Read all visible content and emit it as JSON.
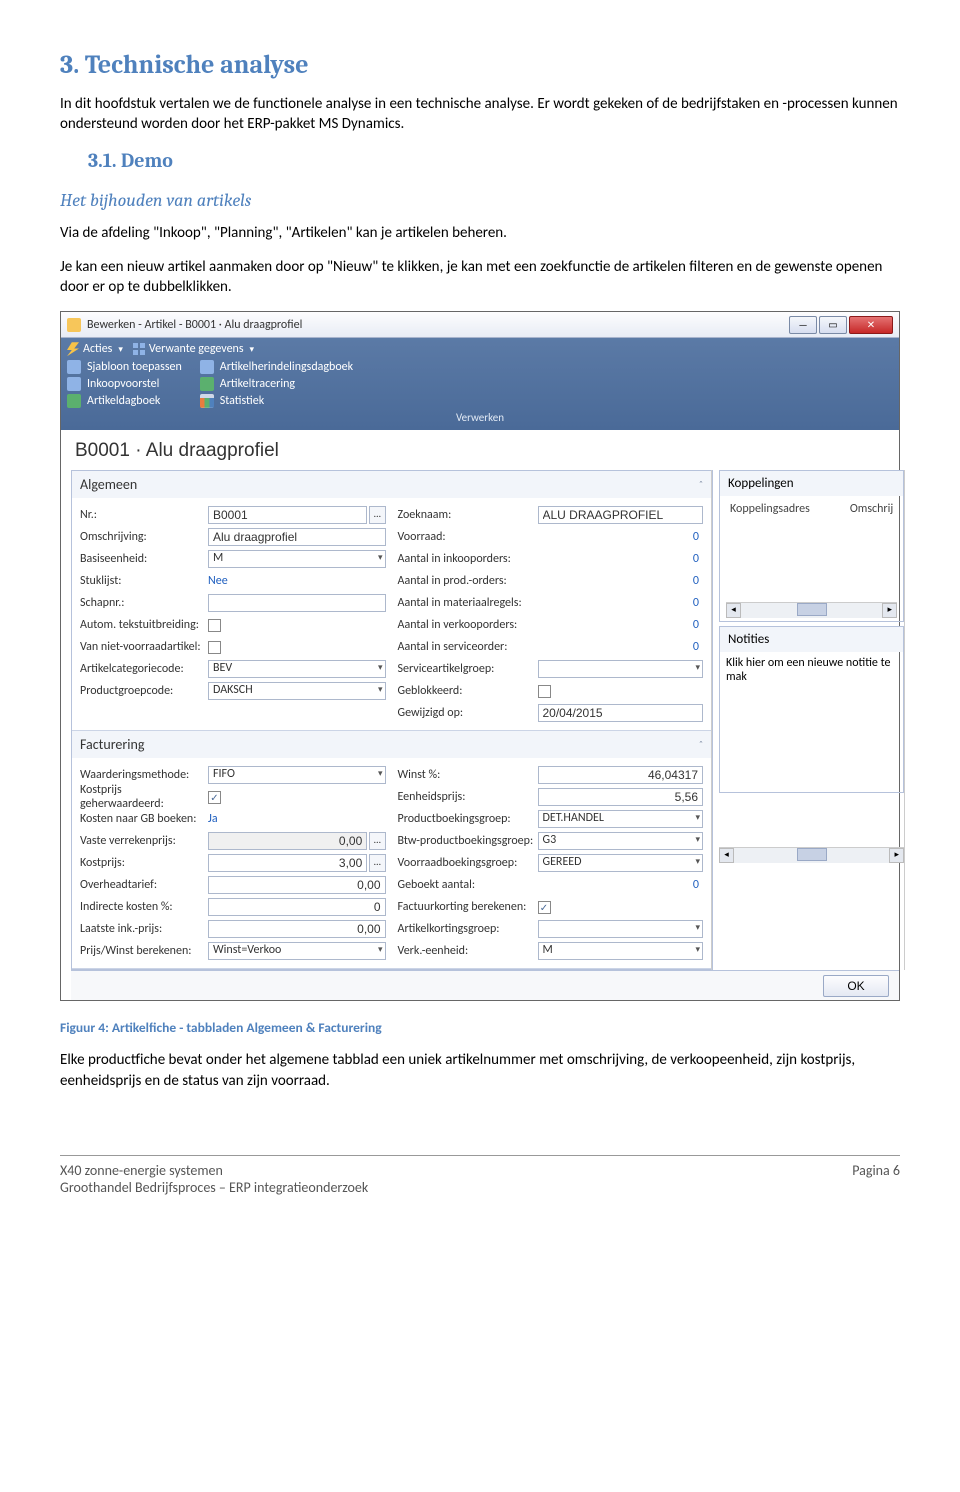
{
  "doc": {
    "h1": "3. Technische analyse",
    "p1": "In dit hoofdstuk vertalen we de functionele analyse in een technische analyse. Er wordt gekeken of de bedrijfstaken en -processen kunnen ondersteund worden door het ERP-pakket MS Dynamics.",
    "h2": "3.1.   Demo",
    "h3": "Het bijhouden van artikels",
    "p2": "Via de afdeling \"Inkoop\", \"Planning\", \"Artikelen\" kan je artikelen beheren.",
    "p3": "Je kan een nieuw artikel aanmaken door op \"Nieuw\" te klikken, je kan met een zoekfunctie de artikelen filteren en de gewenste openen door er op te dubbelklikken.",
    "caption": "Figuur 4: Artikelfiche - tabbladen Algemeen & Facturering",
    "p4": "Elke productfiche bevat onder het algemene tabblad een uniek artikelnummer met omschrijving, de verkoopeenheid, zijn kostprijs, eenheidsprijs en de status van zijn voorraad."
  },
  "win": {
    "title": "Bewerken - Artikel - B0001 · Alu draagprofiel",
    "ribbon": {
      "acties": "Acties",
      "verwante": "Verwante gegevens",
      "col1": [
        "Sjabloon toepassen",
        "Inkoopvoorstel",
        "Artikeldagboek"
      ],
      "col2": [
        "Artikelherindelingsdagboek",
        "Artikeltracering",
        "Statistiek"
      ],
      "group": "Verwerken"
    },
    "doctitle": "B0001 · Alu draagprofiel",
    "section_algemeen": "Algemeen",
    "section_facturering": "Facturering",
    "algemeen_left": {
      "nr": {
        "label": "Nr.:",
        "value": "B0001"
      },
      "omschrijving": {
        "label": "Omschrijving:",
        "value": "Alu draagprofiel"
      },
      "basiseenheid": {
        "label": "Basiseenheid:",
        "value": "M"
      },
      "stuklijst": {
        "label": "Stuklijst:",
        "value": "Nee"
      },
      "schapnr": {
        "label": "Schapnr.:",
        "value": ""
      },
      "autom": {
        "label": "Autom. tekstuitbreiding:",
        "checked": false
      },
      "vanniet": {
        "label": "Van niet-voorraadartikel:",
        "checked": false
      },
      "artcat": {
        "label": "Artikelcategoriecode:",
        "value": "BEV"
      },
      "prodgrp": {
        "label": "Productgroepcode:",
        "value": "DAKSCH"
      }
    },
    "algemeen_right": {
      "zoeknaam": {
        "label": "Zoeknaam:",
        "value": "ALU DRAAGPROFIEL"
      },
      "voorraad": {
        "label": "Voorraad:",
        "value": "0"
      },
      "inkoop": {
        "label": "Aantal in inkooporders:",
        "value": "0"
      },
      "prod": {
        "label": "Aantal in prod.-orders:",
        "value": "0"
      },
      "mat": {
        "label": "Aantal in materiaalregels:",
        "value": "0"
      },
      "verk": {
        "label": "Aantal in verkooporders:",
        "value": "0"
      },
      "serv": {
        "label": "Aantal in serviceorder:",
        "value": "0"
      },
      "servgrp": {
        "label": "Serviceartikelgroep:",
        "value": ""
      },
      "gebl": {
        "label": "Geblokkeerd:",
        "checked": false
      },
      "gewij": {
        "label": "Gewijzigd op:",
        "value": "20/04/2015"
      }
    },
    "fact_left": {
      "waard": {
        "label": "Waarderingsmethode:",
        "value": "FIFO"
      },
      "kostg": {
        "label": "Kostprijs geherwaardeerd:",
        "checked": true
      },
      "kostgb": {
        "label": "Kosten naar GB boeken:",
        "value": "Ja"
      },
      "vaste": {
        "label": "Vaste verrekenprijs:",
        "value": "0,00"
      },
      "kostprijs": {
        "label": "Kostprijs:",
        "value": "3,00"
      },
      "overhead": {
        "label": "Overheadtarief:",
        "value": "0,00"
      },
      "indirect": {
        "label": "Indirecte kosten %:",
        "value": "0"
      },
      "laatste": {
        "label": "Laatste ink.-prijs:",
        "value": "0,00"
      },
      "prijswinst": {
        "label": "Prijs/Winst berekenen:",
        "value": "Winst=Verkoo"
      }
    },
    "fact_right": {
      "winst": {
        "label": "Winst %:",
        "value": "46,04317"
      },
      "eenh": {
        "label": "Eenheidsprijs:",
        "value": "5,56"
      },
      "prodb": {
        "label": "Productboekingsgroep:",
        "value": "DET.HANDEL"
      },
      "btw": {
        "label": "Btw-productboekingsgroep:",
        "value": "G3"
      },
      "voorb": {
        "label": "Voorraadboekingsgroep:",
        "value": "GEREED"
      },
      "geboekt": {
        "label": "Geboekt aantal:",
        "value": "0"
      },
      "factk": {
        "label": "Factuurkorting berekenen:",
        "checked": true
      },
      "artk": {
        "label": "Artikelkortingsgroep:",
        "value": ""
      },
      "verke": {
        "label": "Verk.-eenheid:",
        "value": "M"
      }
    },
    "right": {
      "koppelingen": "Koppelingen",
      "kop_col1": "Koppelingsadres",
      "kop_col2": "Omschrij",
      "notities": "Notities",
      "not_hint": "Klik hier om een nieuwe notitie te mak"
    },
    "ok": "OK"
  },
  "footer": {
    "l1": "X40 zonne-energie systemen",
    "l2": "Groothandel Bedrijfsproces – ERP integratieonderzoek",
    "r": "Pagina 6"
  }
}
